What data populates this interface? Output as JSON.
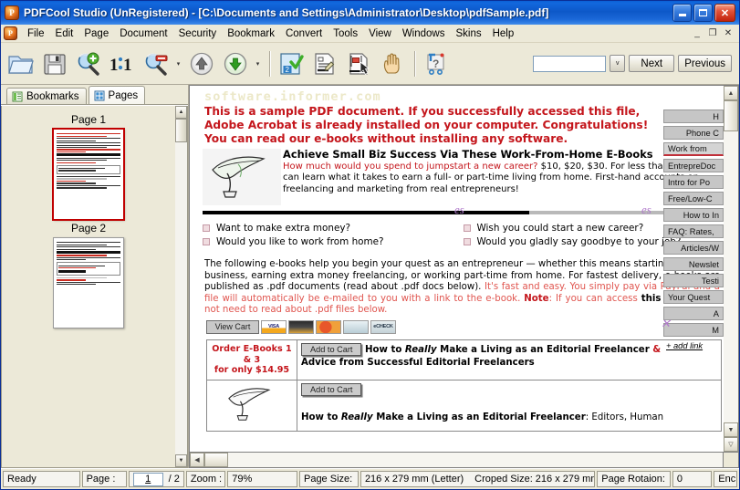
{
  "window": {
    "title": "PDFCool Studio  (UnRegistered) - [C:\\Documents and Settings\\Administrator\\Desktop\\pdfSample.pdf]",
    "app_icon": "P",
    "minimize": "_",
    "maximize": "□",
    "close": "✕",
    "mdi_minimize": "_",
    "mdi_restore": "❐",
    "mdi_close": "✕"
  },
  "menu": {
    "items": [
      "File",
      "Edit",
      "Page",
      "Document",
      "Security",
      "Bookmark",
      "Convert",
      "Tools",
      "View",
      "Windows",
      "Skins",
      "Help"
    ]
  },
  "toolbar": {
    "buttons": [
      {
        "name": "open-button",
        "icon": "folder-open-icon"
      },
      {
        "name": "save-button",
        "icon": "floppy-disk-icon"
      },
      {
        "name": "zoom-in-button",
        "icon": "magnifier-plus-icon"
      },
      {
        "name": "actual-size-button",
        "icon": "one-to-one-icon"
      },
      {
        "name": "zoom-out-button",
        "icon": "magnifier-minus-icon"
      },
      {
        "name": "previous-page-button",
        "icon": "arrow-up-circle-icon"
      },
      {
        "name": "next-page-button",
        "icon": "arrow-down-circle-icon"
      },
      {
        "name": "page-properties-button",
        "icon": "page-check-icon"
      },
      {
        "name": "edit-document-button",
        "icon": "document-edit-icon"
      },
      {
        "name": "select-object-button",
        "icon": "select-arrow-icon"
      },
      {
        "name": "hand-tool-button",
        "icon": "hand-icon"
      },
      {
        "name": "help-button",
        "icon": "help-question-icon"
      }
    ],
    "search_value": "",
    "search_placeholder": "",
    "dropdown_glyph": "v",
    "next_label": "Next",
    "previous_label": "Previous"
  },
  "sidebar": {
    "tabs": [
      {
        "label": "Bookmarks",
        "icon": "bookmarks-icon",
        "active": false
      },
      {
        "label": "Pages",
        "icon": "pages-grid-icon",
        "active": true
      }
    ],
    "thumbnails": [
      {
        "label": "Page 1",
        "selected": true
      },
      {
        "label": "Page 2",
        "selected": false
      }
    ]
  },
  "document": {
    "watermark": "software.informer.com",
    "headline": [
      "This is a sample PDF document. If you successfully accessed this file,",
      "Adobe Acrobat is already installed on your computer. Congratulations!",
      "You can  read our e-books without installing any software."
    ],
    "promo": {
      "heading": "Achieve Small Biz Success Via These Work-From-Home E-Books",
      "body_red_1": "How much would you spend to jumpstart a new career?",
      "body_black": " $10, $20, $30. For less than $10, you can learn what it takes to earn a full- or part-time living from home. First-hand accounts on freelancing and marketing from real entrepreneurs!"
    },
    "questions": [
      "Want to make extra money?",
      "Would you like to work from home?",
      "Wish you could start a new career?",
      "Would you gladly say goodbye to your job?"
    ],
    "paragraph": {
      "black_1": "The following e-books help you begin your quest as an entrepreneur — whether this means starting a full-time business, earning extra money freelancing, or working part-time from home. For fastest delivery, e-books are published as .pdf documents (read about .pdf docs below). ",
      "red_1": "It's fast and easy. You simply pay via PayPal and a file will automatically be e-mailed to you with a link to the e-book. ",
      "note_label": "Note",
      "red_2": ": If you can access ",
      "bold_this": "this",
      "red_3": " link, you do not need to read about .pdf files below."
    },
    "cart": {
      "view_cart_label": "View Cart",
      "payment_logos": [
        "VISA",
        "AMEX",
        "MasterCard",
        "Discover",
        "eCHECK"
      ]
    },
    "order_rows": [
      {
        "offer_line_1": "Order E-Books 1 & 3",
        "offer_line_2": "for only $14.95",
        "button_label": "Add to Cart",
        "title_pre": "How to ",
        "title_italic": "Really",
        "title_post": " Make a Living as an Editorial Freelancer ",
        "title_amp": "&",
        "title_line2": "Advice from Successful Editorial Freelancers"
      },
      {
        "button_label": "Add to Cart",
        "title_pre": "How to ",
        "title_italic": "Really",
        "title_post": " Make a Living as an Editorial Freelancer",
        "title_suffix": ": Editors, Human"
      }
    ],
    "page_nav": [
      {
        "label": "H",
        "current": false
      },
      {
        "label": "Phone C",
        "current": false
      },
      {
        "label": "Work from",
        "current": true
      },
      {
        "label": "EntrepreDoc",
        "current": false
      },
      {
        "label": "Intro for Po",
        "current": false
      },
      {
        "label": "Free/Low-C",
        "current": false
      },
      {
        "label": "How to In",
        "current": false
      },
      {
        "label": "FAQ: Rates,",
        "current": false
      },
      {
        "label": "Articles/W",
        "current": false
      },
      {
        "label": "Newslet",
        "current": false
      },
      {
        "label": "Testi",
        "current": false
      },
      {
        "label": "Your Quest",
        "current": false
      },
      {
        "label": "A",
        "current": false
      },
      {
        "label": "M",
        "current": false
      }
    ],
    "add_link": "+ add link"
  },
  "status": {
    "ready": "Ready",
    "page_label": "Page :",
    "page_value": "1",
    "page_total": "/ 2",
    "zoom_label": "Zoom :",
    "zoom_value": "79%",
    "page_size_label": "Page Size:",
    "page_size_value": "216 x 279 mm (Letter)",
    "cropped_size": "Croped Size: 216 x 279 mm",
    "rotation_label": "Page Rotaion:",
    "rotation_value": "0",
    "encrypt_label": "Enc"
  }
}
